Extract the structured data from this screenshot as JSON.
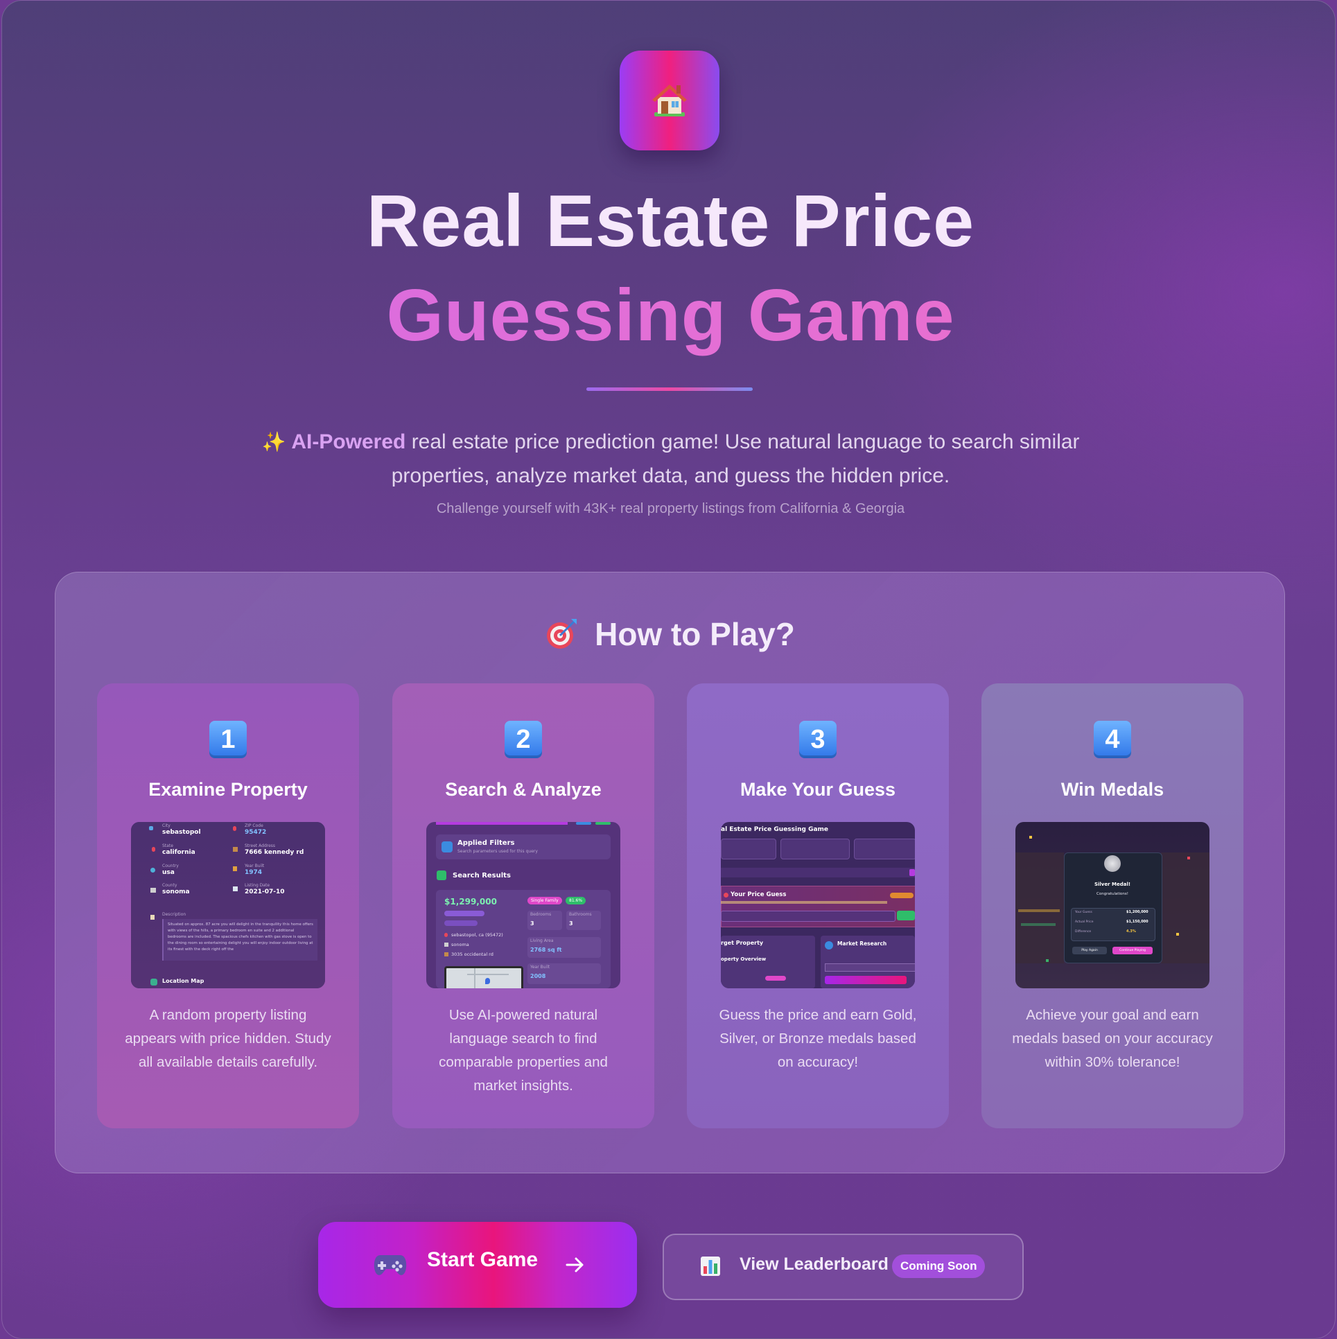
{
  "header": {
    "logo_icon": "house-icon",
    "title_line1": "Real Estate Price",
    "title_line2": "Guessing Game",
    "intro_highlight": "AI-Powered",
    "intro_rest": " real estate price prediction game! Use natural language to search similar properties, analyze market data, and guess the hidden price.",
    "subnote": "Challenge yourself with 43K+ real property listings from California & Georgia"
  },
  "how_to_play": {
    "title": "How to Play?",
    "icon": "target-icon",
    "steps": [
      {
        "number": "1",
        "title": "Examine Property",
        "description": "A random property listing appears with price hidden. Study all available details carefully.",
        "preview": {
          "city_label": "City",
          "city": "sebastopol",
          "zip_label": "ZIP Code",
          "zip": "95472",
          "state_label": "State",
          "state": "california",
          "street_label": "Street Address",
          "street": "7666 kennedy rd",
          "country_label": "Country",
          "country": "usa",
          "year_label": "Year Built",
          "year": "1974",
          "county_label": "County",
          "county": "sonoma",
          "date_label": "Listing Date",
          "date": "2021-07-10",
          "desc_label": "Description",
          "desc_text": "Situated on approx. 87 acre you will delight in the tranquility this home offers with views of the hills, a primary bedroom en suite and 2 additional bedrooms are included. The spacious chefs kitchen with gas stove is open to the dining room so entertaining delight you will enjoy indoor outdoor living at its finest with the deck right off the",
          "map_label": "Location Map"
        }
      },
      {
        "number": "2",
        "title": "Search & Analyze",
        "description": "Use AI-powered natural language search to find comparable properties and market insights.",
        "preview": {
          "filters_title": "Applied Filters",
          "filters_sub": "Search parameters used for this query",
          "results_title": "Search Results",
          "price": "$1,299,000",
          "type_badge": "Single Family",
          "match_badge": "81.6%",
          "location": "sebastopol, ca (95472)",
          "county": "sonoma",
          "street": "3035 occidental rd",
          "bedrooms_label": "Bedrooms",
          "bedrooms": "3",
          "bathrooms_label": "Bathrooms",
          "bathrooms": "3",
          "area_label": "Living Area",
          "area": "2768 sq ft",
          "year_label": "Year Built",
          "year": "2008"
        }
      },
      {
        "number": "3",
        "title": "Make Your Guess",
        "description": "Guess the price and earn Gold, Silver, or Bronze medals based on accuracy!",
        "preview": {
          "header": "al Estate Price Guessing Game",
          "guess_title": "Your Price Guess",
          "target_title": "rget Property",
          "overview_title": "operty Overview",
          "research_title": "Market Research"
        }
      },
      {
        "number": "4",
        "title": "Win Medals",
        "description": "Achieve your goal and earn medals based on your accuracy within 30% tolerance!",
        "preview": {
          "medal_title": "Silver Medal!",
          "congrats": "Congratulations!",
          "your_guess_label": "Your Guess",
          "your_guess": "$1,200,000",
          "actual_label": "Actual Price",
          "actual": "$1,150,000",
          "diff_label": "Difference",
          "diff": "4.3%",
          "play_again": "Play Again",
          "continue": "Continue Playing"
        }
      }
    ]
  },
  "actions": {
    "start_label": "Start Game",
    "start_icon": "gamepad-icon",
    "leaderboard_label": "View Leaderboard",
    "leaderboard_icon": "bar-chart-icon",
    "leaderboard_badge": "Coming Soon"
  },
  "colors": {
    "accent_pink": "#e9157c",
    "accent_purple": "#a727e8",
    "step_badge_blue": "#2f76e8",
    "title_gradient": "#d46ae6"
  }
}
